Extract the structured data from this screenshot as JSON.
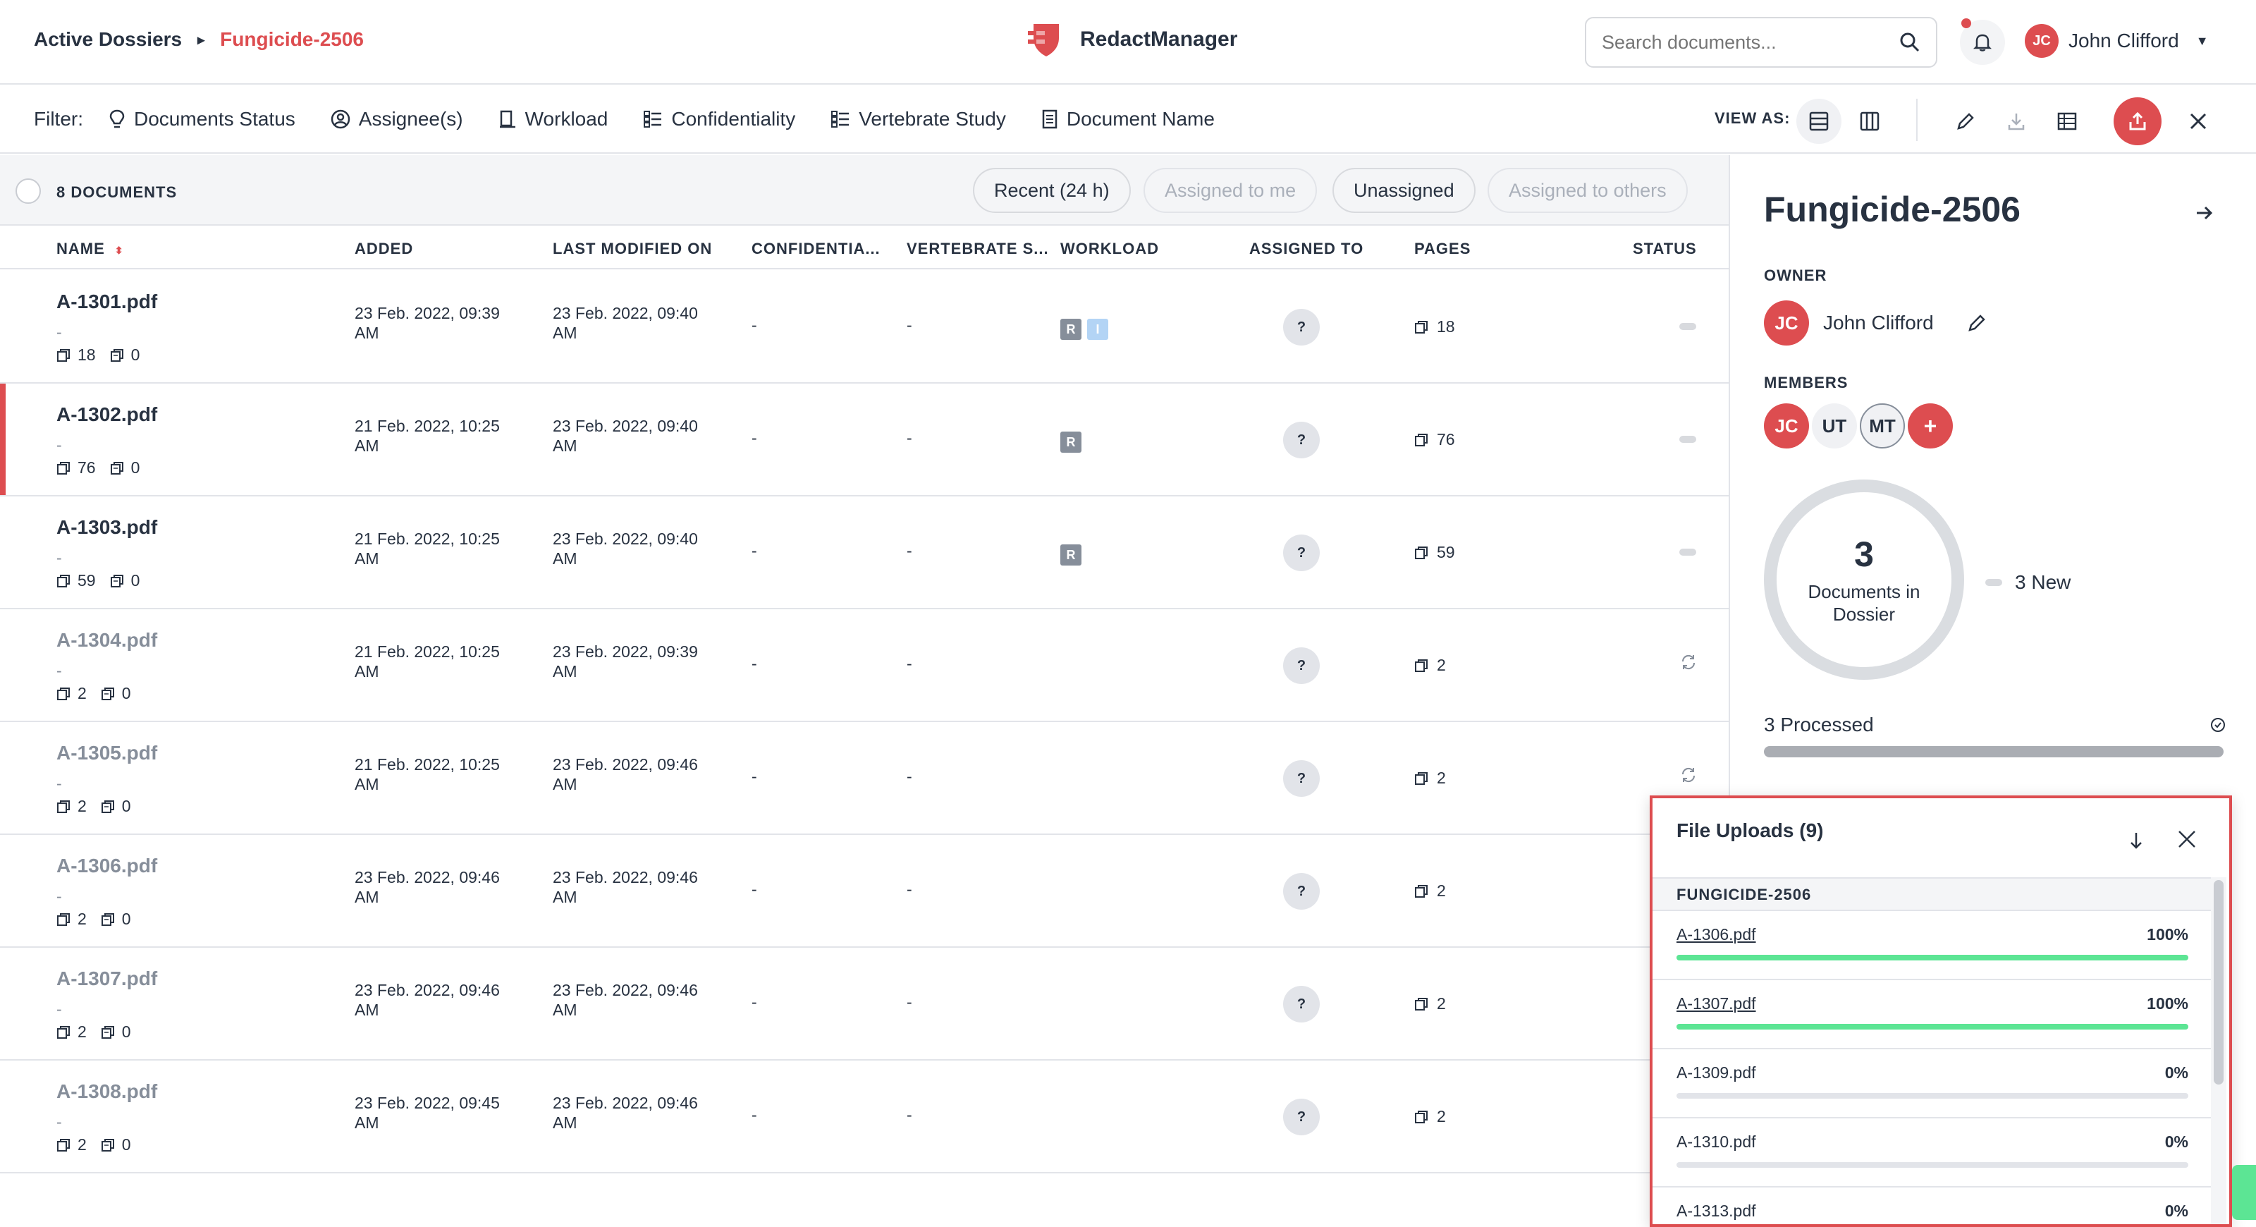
{
  "header": {
    "breadcrumb": {
      "root": "Active Dossiers",
      "current": "Fungicide-2506"
    },
    "app_name": "RedactManager",
    "search_placeholder": "Search documents...",
    "user": {
      "initials": "JC",
      "name": "John Clifford"
    }
  },
  "filters": {
    "label": "Filter:",
    "items": [
      "Documents Status",
      "Assignee(s)",
      "Workload",
      "Confidentiality",
      "Vertebrate Study",
      "Document Name"
    ],
    "view_as": "VIEW AS:"
  },
  "list": {
    "count_label": "8 DOCUMENTS",
    "chips": [
      "Recent (24 h)",
      "Assigned to me",
      "Unassigned",
      "Assigned to others"
    ],
    "columns": [
      "NAME",
      "ADDED",
      "LAST MODIFIED ON",
      "CONFIDENTIA...",
      "VERTEBRATE S...",
      "WORKLOAD",
      "ASSIGNED TO",
      "PAGES",
      "STATUS"
    ],
    "rows": [
      {
        "name": "A-1301.pdf",
        "sub": "-",
        "pages_stat": "18",
        "annot_stat": "0",
        "added": "23 Feb. 2022, 09:39 AM",
        "modified": "23 Feb. 2022, 09:40 AM",
        "conf": "-",
        "vert": "-",
        "workload": [
          "R",
          "I"
        ],
        "assigned": "?",
        "pages": "18",
        "status": "pill"
      },
      {
        "name": "A-1302.pdf",
        "sub": "-",
        "pages_stat": "76",
        "annot_stat": "0",
        "added": "21 Feb. 2022, 10:25 AM",
        "modified": "23 Feb. 2022, 09:40 AM",
        "conf": "-",
        "vert": "-",
        "workload": [
          "R"
        ],
        "assigned": "?",
        "pages": "76",
        "status": "pill"
      },
      {
        "name": "A-1303.pdf",
        "sub": "-",
        "pages_stat": "59",
        "annot_stat": "0",
        "added": "21 Feb. 2022, 10:25 AM",
        "modified": "23 Feb. 2022, 09:40 AM",
        "conf": "-",
        "vert": "-",
        "workload": [
          "R"
        ],
        "assigned": "?",
        "pages": "59",
        "status": "pill"
      },
      {
        "name": "A-1304.pdf",
        "sub": "-",
        "pages_stat": "2",
        "annot_stat": "0",
        "added": "21 Feb. 2022, 10:25 AM",
        "modified": "23 Feb. 2022, 09:39 AM",
        "conf": "-",
        "vert": "-",
        "workload": [],
        "assigned": "?",
        "pages": "2",
        "status": "sync"
      },
      {
        "name": "A-1305.pdf",
        "sub": "-",
        "pages_stat": "2",
        "annot_stat": "0",
        "added": "21 Feb. 2022, 10:25 AM",
        "modified": "23 Feb. 2022, 09:46 AM",
        "conf": "-",
        "vert": "-",
        "workload": [],
        "assigned": "?",
        "pages": "2",
        "status": "sync"
      },
      {
        "name": "A-1306.pdf",
        "sub": "-",
        "pages_stat": "2",
        "annot_stat": "0",
        "added": "23 Feb. 2022, 09:46 AM",
        "modified": "23 Feb. 2022, 09:46 AM",
        "conf": "-",
        "vert": "-",
        "workload": [],
        "assigned": "?",
        "pages": "2",
        "status": "none"
      },
      {
        "name": "A-1307.pdf",
        "sub": "-",
        "pages_stat": "2",
        "annot_stat": "0",
        "added": "23 Feb. 2022, 09:46 AM",
        "modified": "23 Feb. 2022, 09:46 AM",
        "conf": "-",
        "vert": "-",
        "workload": [],
        "assigned": "?",
        "pages": "2",
        "status": "none"
      },
      {
        "name": "A-1308.pdf",
        "sub": "-",
        "pages_stat": "2",
        "annot_stat": "0",
        "added": "23 Feb. 2022, 09:45 AM",
        "modified": "23 Feb. 2022, 09:46 AM",
        "conf": "-",
        "vert": "-",
        "workload": [],
        "assigned": "?",
        "pages": "2",
        "status": "none"
      }
    ]
  },
  "panel": {
    "title": "Fungicide-2506",
    "owner_label": "OWNER",
    "owner": {
      "initials": "JC",
      "name": "John Clifford"
    },
    "members_label": "MEMBERS",
    "members": [
      "JC",
      "UT",
      "MT"
    ],
    "add_member": "+",
    "donut": {
      "count": "3",
      "label": "Documents in Dossier"
    },
    "legend": "3 New",
    "processed": "3 Processed"
  },
  "uploads": {
    "title": "File Uploads (9)",
    "group": "FUNGICIDE-2506",
    "items": [
      {
        "name": "A-1306.pdf",
        "pct": "100%",
        "progress": 1.0,
        "link": true
      },
      {
        "name": "A-1307.pdf",
        "pct": "100%",
        "progress": 1.0,
        "link": true
      },
      {
        "name": "A-1309.pdf",
        "pct": "0%",
        "progress": 0.0,
        "link": false
      },
      {
        "name": "A-1310.pdf",
        "pct": "0%",
        "progress": 0.0,
        "link": false
      },
      {
        "name": "A-1313.pdf",
        "pct": "0%",
        "progress": 0.0,
        "link": false
      }
    ]
  },
  "colors": {
    "accent": "#dd4d50",
    "progress": "#5ce594",
    "text": "#283241",
    "muted": "#868e9a"
  }
}
